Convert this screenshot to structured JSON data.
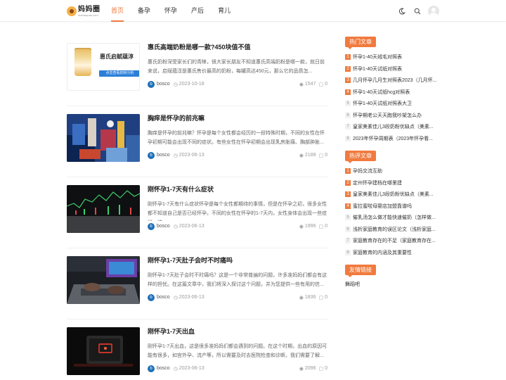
{
  "logo": {
    "name": "妈妈圈",
    "url": "mamaquan.com"
  },
  "nav": [
    {
      "label": "首页",
      "active": true
    },
    {
      "label": "备孕",
      "active": false
    },
    {
      "label": "怀孕",
      "active": false
    },
    {
      "label": "产后",
      "active": false
    },
    {
      "label": "育儿",
      "active": false
    }
  ],
  "header_icons": [
    "moon-icon",
    "search-icon",
    "user-avatar"
  ],
  "accent_color": "#f07b3f",
  "posts": [
    {
      "title": "惠氏高端奶粉是哪一款?450块值不值",
      "excerpt": "惠氏奶粉深受家长们的青睐，很大家长朋友不知道惠氏高端奶粉是哪一款，就日前来说，启赋蕴淳是惠氏售价最高的奶粉，每罐高达450元，那么它的品质怎...",
      "author": "bosco",
      "date": "2023-10-18",
      "views": "1547",
      "comments": "0",
      "thumb_brand": "惠氏启赋蕴淳",
      "thumb_cta": "点击查看奶粉分析"
    },
    {
      "title": "胸痒是怀孕的前兆嘛",
      "excerpt": "胸痒是怀孕的前兆嘛？怀孕是每个女性都会经历的一段特殊时期，不同的女性在怀孕初期可能会出现不同的症状。有些女性在怀孕初期会出现乳房胀痛、胸部肿胀...",
      "author": "bosco",
      "date": "2023-06-13",
      "views": "2188",
      "comments": "0"
    },
    {
      "title": "刚怀孕1-7天有什么症状",
      "excerpt": "刚怀孕1-7天有什么症状怀孕是每个女性都期待的事情，但是在怀孕之初，很多女性都不知道自己是否已经怀孕。不同的女性在怀孕的1-7天内，女性身体会出现一些症状，这...",
      "author": "bosco",
      "date": "2023-06-13",
      "views": "1996",
      "comments": "0"
    },
    {
      "title": "刚怀孕1-7天肚子会时不时痛吗",
      "excerpt": "刚怀孕1-7天肚子会时不时痛吗？这是一个非常普遍的问题，许多准妈妈们都会有这样的担忧。在这篇文章中，我们将深入探讨这个问题，并为您提供一些有用的信...",
      "author": "bosco",
      "date": "2023-06-13",
      "views": "1836",
      "comments": "0"
    },
    {
      "title": "刚怀孕1-7天出血",
      "excerpt": "刚怀孕1-7天出血，这是很多准妈妈们都会遇到的问题。在这个时期，出血的原因可能有很多，如宫外孕、流产等，所以需要及时去医院检查和诊断。我们需要了解...",
      "author": "bosco",
      "date": "2023-06-13",
      "views": "2096",
      "comments": "0"
    }
  ],
  "sidebar": {
    "hot_articles": {
      "title": "热门文章",
      "items": [
        "怀孕1-40天绒毛对照表",
        "怀孕1-40天试纸对照表",
        "几月怀孕几月生对照表2023（几月怀...",
        "怀孕1-40天试纸hcg对照表",
        "怀孕1-40天试纸对照表大卫",
        "怀孕期老公天天跑我吵架怎么办",
        "皇家美素佳儿3段奶粉优缺点（美素...",
        "2023年怀孕周期表（2023年怀孕看..."
      ]
    },
    "hot_reviews": {
      "title": "热评文章",
      "items": [
        "孕妈交流互助",
        "定州怀孕建档在哪里建",
        "皇家美素佳儿3段奶粉优缺点（美素...",
        "蜜拉蜜啦母婴店加盟靠谱吗",
        "催乳汤怎么做才能快速催奶（怎样做...",
        "浅析家庭教育的误区论文（浅析家庭...",
        "家庭教育存在的不足（家庭教育存在...",
        "家庭教育的内涵及其重要性"
      ]
    },
    "friend_links": {
      "title": "友情链接",
      "items": [
        "舞蹈吧"
      ]
    }
  }
}
